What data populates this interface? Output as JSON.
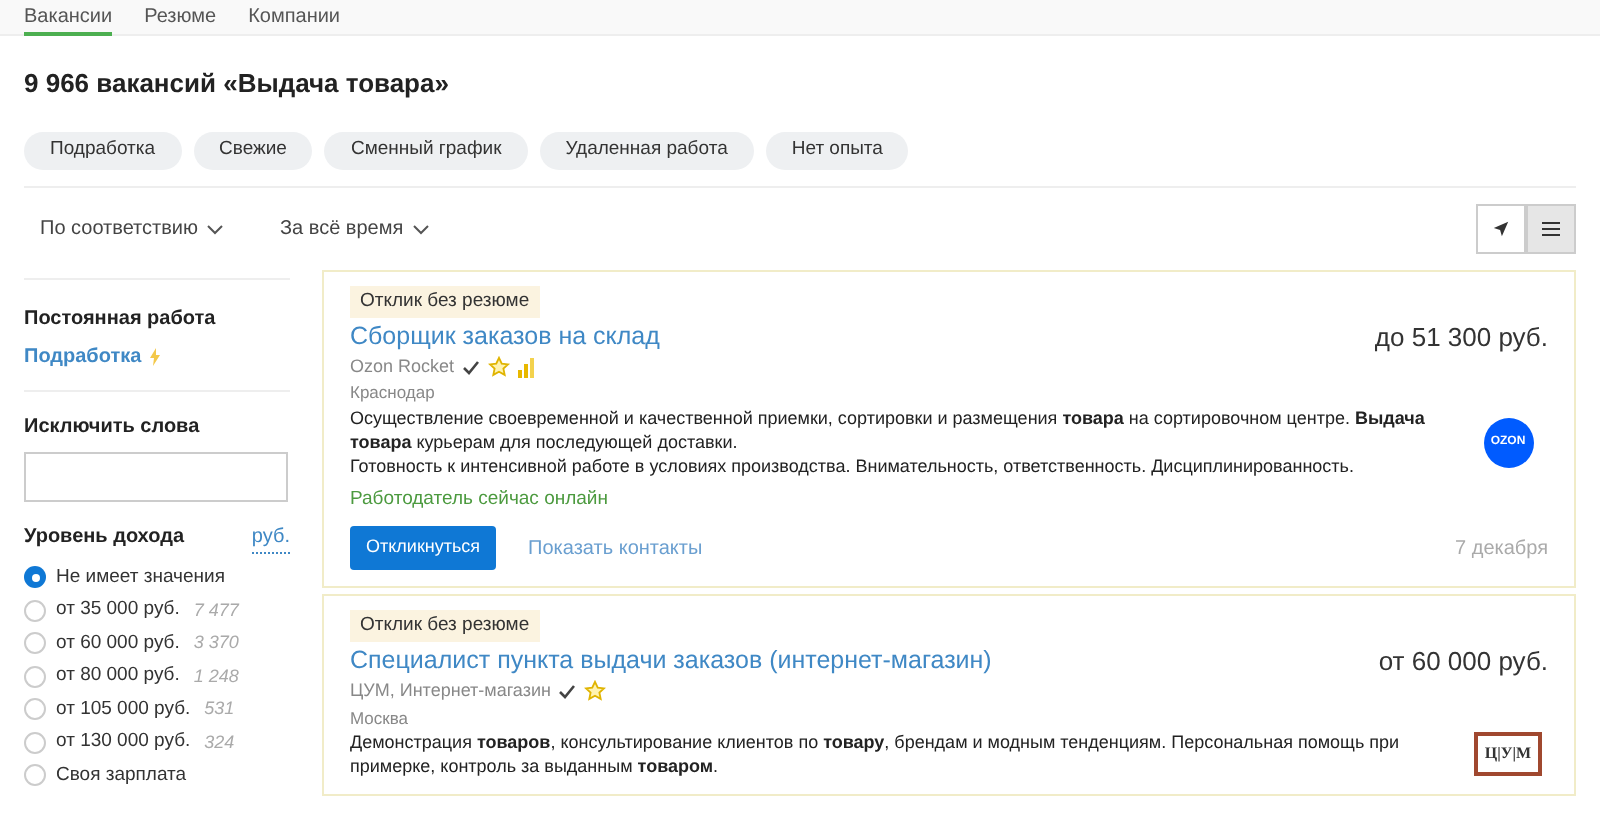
{
  "tabs": [
    {
      "label": "Вакансии",
      "selected": true
    },
    {
      "label": "Резюме",
      "selected": false
    },
    {
      "label": "Компании",
      "selected": false
    }
  ],
  "heading": "9 966 вакансий «Выдача товара»",
  "chips": [
    "Подработка",
    "Свежие",
    "Сменный график",
    "Удаленная работа",
    "Нет опыта"
  ],
  "sort": [
    "По соответствию",
    "За всё время"
  ],
  "view_buttons": [
    {
      "kind": "map",
      "selected": false
    },
    {
      "kind": "list",
      "selected": true
    }
  ],
  "sidebar": {
    "employment_title": "Постоянная работа",
    "employment_link": "Подработка",
    "exclude_title": "Исключить слова",
    "income_title": "Уровень дохода",
    "currency": "руб.",
    "income_options": [
      {
        "label": "Не имеет значения",
        "selected": true
      },
      {
        "label": "от 35 000 руб.",
        "count": "7 477",
        "selected": false
      },
      {
        "label": "от 60 000 руб.",
        "count": "3 370",
        "selected": false
      },
      {
        "label": "от 80 000 руб.",
        "count": "1 248",
        "selected": false
      },
      {
        "label": "от 105 000 руб.",
        "count": "531",
        "selected": false
      },
      {
        "label": "от 130 000 руб.",
        "count": "324",
        "selected": false
      },
      {
        "label": "Своя зарплата",
        "selected": false
      }
    ]
  },
  "vacancies": [
    {
      "badge": "Отклик без резюме",
      "title": "Сборщик заказов на склад",
      "salary": "до 51 300 руб.",
      "company": "Ozon Rocket",
      "verified": true,
      "top_rated": true,
      "growth": true,
      "city": "Краснодар",
      "logo": {
        "kind": "circle",
        "text": "OZON"
      },
      "description": [
        "Осуществление своевременной и качественной приемки, сортировки и размещения **товара** на сортировочном центре. **Выдача товара** курьерам для последующей доставки.",
        "Готовность к интенсивной работе в условиях производства. Внимательность, ответственность. Дисциплинированность."
      ],
      "online": "Работодатель сейчас онлайн",
      "respond": "Откликнуться",
      "contacts": "Показать контакты",
      "date": "7 декабря"
    },
    {
      "badge": "Отклик без резюме",
      "title": "Специалист пункта выдачи заказов (интернет-магазин)",
      "salary": "от 60 000 руб.",
      "company": "ЦУМ, Интернет-магазин",
      "verified": true,
      "top_rated": true,
      "growth": false,
      "city": "Москва",
      "logo": {
        "kind": "framed",
        "text": "Ц|У|М"
      },
      "description": [
        "Демонстрация **товаров**, консультирование клиентов по **товару**, брендам и модным тенденциям. Персональная помощь при примерке, контроль за выданным **товаром**."
      ]
    }
  ]
}
